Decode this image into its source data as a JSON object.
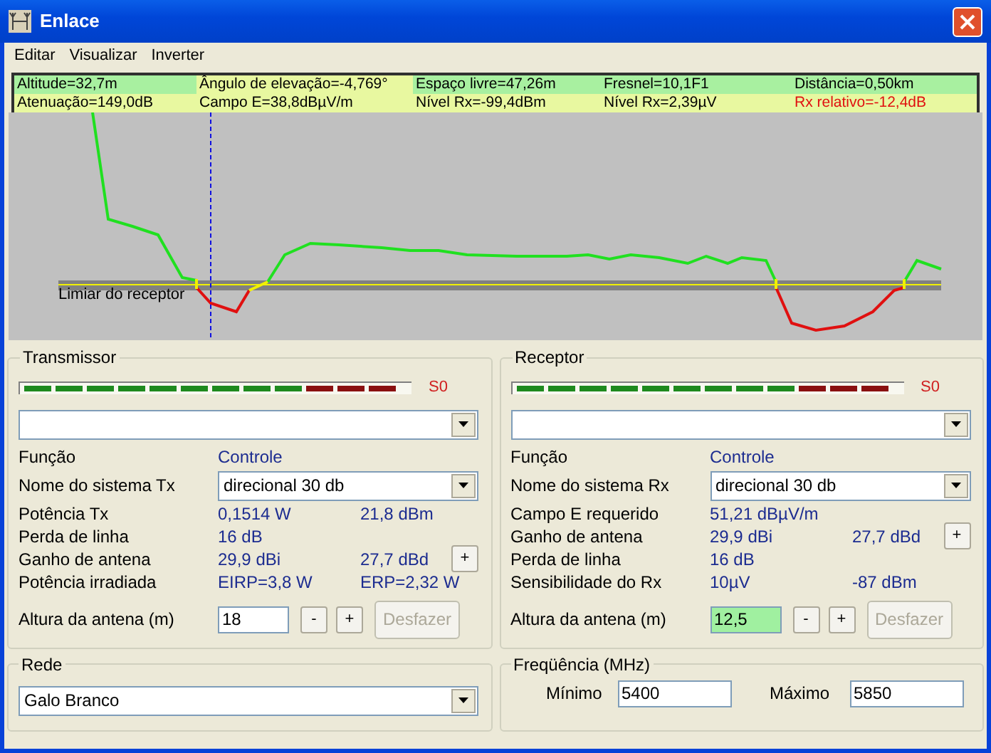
{
  "window": {
    "title": "Enlace"
  },
  "menu": [
    "Editar",
    "Visualizar",
    "Inverter"
  ],
  "info_rows": [
    [
      {
        "text": "Altitude=32,7m",
        "color": "#a8f0a0",
        "alert": false
      },
      {
        "text": "Ângulo de elevação=-4,769°",
        "color": "#e8f8a0",
        "alert": false
      },
      {
        "text": "Espaço livre=47,26m",
        "color": "#a8f0a0",
        "alert": false
      },
      {
        "text": "Fresnel=10,1F1",
        "color": "#a8f0a0",
        "alert": false
      },
      {
        "text": "Distância=0,50km",
        "color": "#a8f0a0",
        "alert": false
      }
    ],
    [
      {
        "text": "Atenuação=149,0dB",
        "color": "#e8f8a0",
        "alert": false
      },
      {
        "text": "Campo E=38,8dBµV/m",
        "color": "#e8f8a0",
        "alert": false
      },
      {
        "text": "Nível Rx=-99,4dBm",
        "color": "#e8f8a0",
        "alert": false
      },
      {
        "text": "Nível Rx=2,39µV",
        "color": "#e8f8a0",
        "alert": false
      },
      {
        "text": "Rx relativo=-12,4dB",
        "color": "#e8f8a0",
        "alert": true
      }
    ]
  ],
  "profile": {
    "threshold_label": "Limiar do receptor"
  },
  "panels": [
    {
      "title": "Transmissor",
      "meter_reading": "S0",
      "funcao_label": "Função",
      "funcao_value": "Controle",
      "system_label": "Nome do sistema Tx",
      "system_value": "direcional 30 db",
      "rows": [
        {
          "label": "Potência Tx",
          "v1": "0,1514 W",
          "v2": "21,8 dBm",
          "plus": false
        },
        {
          "label": "Perda de linha",
          "v1": "16 dB",
          "plus": false
        },
        {
          "label": "Ganho de antena",
          "v1": "29,9 dBi",
          "v2": "27,7 dBd",
          "plus": true
        },
        {
          "label": "Potência irradiada",
          "v1": "EIRP=3,8 W",
          "v2": "ERP=2,32 W",
          "plus": false
        }
      ],
      "height_label": "Altura da antena (m)",
      "height_value": "18",
      "height_highlighted": false,
      "minus": "-",
      "plus": "+",
      "undo": "Desfazer",
      "undo_disabled": true,
      "row_plus": "+"
    },
    {
      "title": "Receptor",
      "meter_reading": "S0",
      "funcao_label": "Função",
      "funcao_value": "Controle",
      "system_label": "Nome do sistema Rx",
      "system_value": "direcional 30 db",
      "rows": [
        {
          "label": "Campo E requerido",
          "v1": "51,21 dBµV/m",
          "plus": false
        },
        {
          "label": "Ganho de antena",
          "v1": "29,9 dBi",
          "v2": "27,7 dBd",
          "plus": true
        },
        {
          "label": "Perda de linha",
          "v1": "16 dB",
          "plus": false
        },
        {
          "label": "Sensibilidade do Rx",
          "v1": "10µV",
          "v2": "-87 dBm",
          "plus": false
        }
      ],
      "height_label": "Altura da antena (m)",
      "height_value": "12,5",
      "height_highlighted": true,
      "minus": "-",
      "plus": "+",
      "undo": "Desfazer",
      "undo_disabled": true,
      "row_plus": "+"
    }
  ],
  "rede": {
    "title": "Rede",
    "value": "Galo Branco"
  },
  "frequencia": {
    "title": "Freqüência (MHz)",
    "min_label": "Mínimo",
    "min_value": "5400",
    "max_label": "Máximo",
    "max_value": "5850"
  }
}
